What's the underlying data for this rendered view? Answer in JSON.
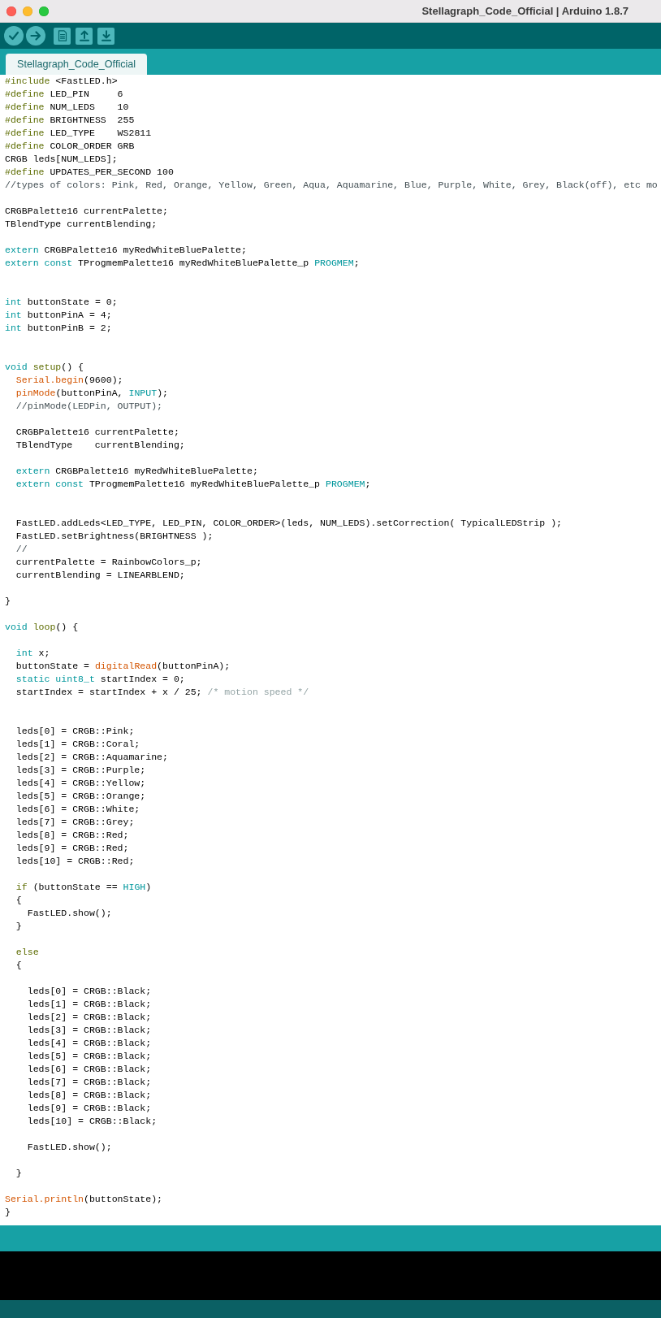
{
  "window": {
    "title": "Stellagraph_Code_Official | Arduino 1.8.7"
  },
  "toolbar": {
    "buttons": [
      {
        "kind": "verify"
      },
      {
        "kind": "upload"
      },
      {
        "kind": "new"
      },
      {
        "kind": "open"
      },
      {
        "kind": "save"
      }
    ]
  },
  "tabs": [
    {
      "label": "Stellagraph_Code_Official",
      "selected": true
    }
  ],
  "editor": {
    "lines": [
      {
        "kind": "code",
        "segments": [
          {
            "kind": "preprocessor",
            "text": "#include"
          },
          {
            "kind": "plain",
            "text": " <FastLED.h>"
          }
        ]
      },
      {
        "kind": "code",
        "segments": [
          {
            "kind": "preprocessor",
            "text": "#define"
          },
          {
            "kind": "plain",
            "text": " LED_PIN     6"
          }
        ]
      },
      {
        "kind": "code",
        "segments": [
          {
            "kind": "preprocessor",
            "text": "#define"
          },
          {
            "kind": "plain",
            "text": " NUM_LEDS    10"
          }
        ]
      },
      {
        "kind": "code",
        "segments": [
          {
            "kind": "preprocessor",
            "text": "#define"
          },
          {
            "kind": "plain",
            "text": " BRIGHTNESS  255"
          }
        ]
      },
      {
        "kind": "code",
        "segments": [
          {
            "kind": "preprocessor",
            "text": "#define"
          },
          {
            "kind": "plain",
            "text": " LED_TYPE    WS2811"
          }
        ]
      },
      {
        "kind": "code",
        "segments": [
          {
            "kind": "preprocessor",
            "text": "#define"
          },
          {
            "kind": "plain",
            "text": " COLOR_ORDER GRB"
          }
        ]
      },
      {
        "kind": "code",
        "segments": [
          {
            "kind": "plain",
            "text": "CRGB leds[NUM_LEDS];"
          }
        ]
      },
      {
        "kind": "code",
        "segments": [
          {
            "kind": "preprocessor",
            "text": "#define"
          },
          {
            "kind": "plain",
            "text": " UPDATES_PER_SECOND 100"
          }
        ]
      },
      {
        "kind": "code",
        "segments": [
          {
            "kind": "comment",
            "text": "//types of colors: Pink, Red, Orange, Yellow, Green, Aqua, Aquamarine, Blue, Purple, White, Grey, Black(off), etc mo"
          }
        ]
      },
      {
        "kind": "blank"
      },
      {
        "kind": "code",
        "segments": [
          {
            "kind": "plain",
            "text": "CRGBPalette16 currentPalette;"
          }
        ]
      },
      {
        "kind": "code",
        "segments": [
          {
            "kind": "plain",
            "text": "TBlendType currentBlending;"
          }
        ]
      },
      {
        "kind": "blank"
      },
      {
        "kind": "code",
        "segments": [
          {
            "kind": "keyword",
            "text": "extern"
          },
          {
            "kind": "plain",
            "text": " CRGBPalette16 myRedWhiteBluePalette;"
          }
        ]
      },
      {
        "kind": "code",
        "segments": [
          {
            "kind": "keyword",
            "text": "extern const"
          },
          {
            "kind": "plain",
            "text": " TProgmemPalette16 myRedWhiteBluePalette_p "
          },
          {
            "kind": "keyword",
            "text": "PROGMEM"
          },
          {
            "kind": "plain",
            "text": ";"
          }
        ]
      },
      {
        "kind": "blank"
      },
      {
        "kind": "blank"
      },
      {
        "kind": "code",
        "segments": [
          {
            "kind": "keyword",
            "text": "int"
          },
          {
            "kind": "plain",
            "text": " buttonState = 0;"
          }
        ]
      },
      {
        "kind": "code",
        "segments": [
          {
            "kind": "keyword",
            "text": "int"
          },
          {
            "kind": "plain",
            "text": " buttonPinA = 4;"
          }
        ]
      },
      {
        "kind": "code",
        "segments": [
          {
            "kind": "keyword",
            "text": "int"
          },
          {
            "kind": "plain",
            "text": " buttonPinB = 2;"
          }
        ]
      },
      {
        "kind": "blank"
      },
      {
        "kind": "blank"
      },
      {
        "kind": "code",
        "segments": [
          {
            "kind": "keyword",
            "text": "void"
          },
          {
            "kind": "control",
            "text": " setup"
          },
          {
            "kind": "plain",
            "text": "() {"
          }
        ]
      },
      {
        "kind": "code",
        "segments": [
          {
            "kind": "function",
            "text": "  Serial.begin"
          },
          {
            "kind": "plain",
            "text": "(9600);"
          }
        ]
      },
      {
        "kind": "code",
        "segments": [
          {
            "kind": "function",
            "text": "  pinMode"
          },
          {
            "kind": "plain",
            "text": "(buttonPinA, "
          },
          {
            "kind": "keyword",
            "text": "INPUT"
          },
          {
            "kind": "plain",
            "text": ");"
          }
        ]
      },
      {
        "kind": "code",
        "segments": [
          {
            "kind": "comment",
            "text": "  //pinMode(LEDPin, OUTPUT);"
          }
        ]
      },
      {
        "kind": "blank"
      },
      {
        "kind": "code",
        "segments": [
          {
            "kind": "plain",
            "text": "  CRGBPalette16 currentPalette;"
          }
        ]
      },
      {
        "kind": "code",
        "segments": [
          {
            "kind": "plain",
            "text": "  TBlendType    currentBlending;"
          }
        ]
      },
      {
        "kind": "blank"
      },
      {
        "kind": "code",
        "segments": [
          {
            "kind": "keyword",
            "text": "  extern"
          },
          {
            "kind": "plain",
            "text": " CRGBPalette16 myRedWhiteBluePalette;"
          }
        ]
      },
      {
        "kind": "code",
        "segments": [
          {
            "kind": "keyword",
            "text": "  extern const"
          },
          {
            "kind": "plain",
            "text": " TProgmemPalette16 myRedWhiteBluePalette_p "
          },
          {
            "kind": "keyword",
            "text": "PROGMEM"
          },
          {
            "kind": "plain",
            "text": ";"
          }
        ]
      },
      {
        "kind": "blank"
      },
      {
        "kind": "blank"
      },
      {
        "kind": "code",
        "segments": [
          {
            "kind": "plain",
            "text": "  FastLED.addLeds<LED_TYPE, LED_PIN, COLOR_ORDER>(leds, NUM_LEDS).setCorrection( TypicalLEDStrip );"
          }
        ]
      },
      {
        "kind": "code",
        "segments": [
          {
            "kind": "plain",
            "text": "  FastLED.setBrightness(BRIGHTNESS );"
          }
        ]
      },
      {
        "kind": "code",
        "segments": [
          {
            "kind": "comment",
            "text": "  //"
          }
        ]
      },
      {
        "kind": "code",
        "segments": [
          {
            "kind": "plain",
            "text": "  currentPalette = RainbowColors_p;"
          }
        ]
      },
      {
        "kind": "code",
        "segments": [
          {
            "kind": "plain",
            "text": "  currentBlending = LINEARBLEND;"
          }
        ]
      },
      {
        "kind": "blank"
      },
      {
        "kind": "code",
        "segments": [
          {
            "kind": "plain",
            "text": "}"
          }
        ]
      },
      {
        "kind": "blank"
      },
      {
        "kind": "code",
        "segments": [
          {
            "kind": "keyword",
            "text": "void"
          },
          {
            "kind": "control",
            "text": " loop"
          },
          {
            "kind": "plain",
            "text": "() {"
          }
        ]
      },
      {
        "kind": "blank"
      },
      {
        "kind": "code",
        "segments": [
          {
            "kind": "keyword",
            "text": "  int"
          },
          {
            "kind": "plain",
            "text": " x;"
          }
        ]
      },
      {
        "kind": "code",
        "segments": [
          {
            "kind": "plain",
            "text": "  buttonState = "
          },
          {
            "kind": "function",
            "text": "digitalRead"
          },
          {
            "kind": "plain",
            "text": "(buttonPinA);"
          }
        ]
      },
      {
        "kind": "code",
        "segments": [
          {
            "kind": "keyword",
            "text": "  static uint8_t"
          },
          {
            "kind": "plain",
            "text": " startIndex = 0;"
          }
        ]
      },
      {
        "kind": "code",
        "segments": [
          {
            "kind": "plain",
            "text": "  startIndex = startIndex + x / 25; "
          },
          {
            "kind": "block_comment",
            "text": "/* motion speed */"
          }
        ]
      },
      {
        "kind": "blank"
      },
      {
        "kind": "blank"
      },
      {
        "kind": "code",
        "segments": [
          {
            "kind": "plain",
            "text": "  leds[0] = CRGB::Pink;"
          }
        ]
      },
      {
        "kind": "code",
        "segments": [
          {
            "kind": "plain",
            "text": "  leds[1] = CRGB::Coral;"
          }
        ]
      },
      {
        "kind": "code",
        "segments": [
          {
            "kind": "plain",
            "text": "  leds[2] = CRGB::Aquamarine;"
          }
        ]
      },
      {
        "kind": "code",
        "segments": [
          {
            "kind": "plain",
            "text": "  leds[3] = CRGB::Purple;"
          }
        ]
      },
      {
        "kind": "code",
        "segments": [
          {
            "kind": "plain",
            "text": "  leds[4] = CRGB::Yellow;"
          }
        ]
      },
      {
        "kind": "code",
        "segments": [
          {
            "kind": "plain",
            "text": "  leds[5] = CRGB::Orange;"
          }
        ]
      },
      {
        "kind": "code",
        "segments": [
          {
            "kind": "plain",
            "text": "  leds[6] = CRGB::White;"
          }
        ]
      },
      {
        "kind": "code",
        "segments": [
          {
            "kind": "plain",
            "text": "  leds[7] = CRGB::Grey;"
          }
        ]
      },
      {
        "kind": "code",
        "segments": [
          {
            "kind": "plain",
            "text": "  leds[8] = CRGB::Red;"
          }
        ]
      },
      {
        "kind": "code",
        "segments": [
          {
            "kind": "plain",
            "text": "  leds[9] = CRGB::Red;"
          }
        ]
      },
      {
        "kind": "code",
        "segments": [
          {
            "kind": "plain",
            "text": "  leds[10] = CRGB::Red;"
          }
        ]
      },
      {
        "kind": "blank"
      },
      {
        "kind": "code",
        "segments": [
          {
            "kind": "control",
            "text": "  if"
          },
          {
            "kind": "plain",
            "text": " (buttonState == "
          },
          {
            "kind": "keyword",
            "text": "HIGH"
          },
          {
            "kind": "plain",
            "text": ")"
          }
        ]
      },
      {
        "kind": "code",
        "segments": [
          {
            "kind": "plain",
            "text": "  {"
          }
        ]
      },
      {
        "kind": "code",
        "segments": [
          {
            "kind": "plain",
            "text": "    FastLED.show();"
          }
        ]
      },
      {
        "kind": "code",
        "segments": [
          {
            "kind": "plain",
            "text": "  }"
          }
        ]
      },
      {
        "kind": "blank"
      },
      {
        "kind": "code",
        "segments": [
          {
            "kind": "control",
            "text": "  else"
          }
        ]
      },
      {
        "kind": "code",
        "segments": [
          {
            "kind": "plain",
            "text": "  {"
          }
        ]
      },
      {
        "kind": "blank"
      },
      {
        "kind": "code",
        "segments": [
          {
            "kind": "plain",
            "text": "    leds[0] = CRGB::Black;"
          }
        ]
      },
      {
        "kind": "code",
        "segments": [
          {
            "kind": "plain",
            "text": "    leds[1] = CRGB::Black;"
          }
        ]
      },
      {
        "kind": "code",
        "segments": [
          {
            "kind": "plain",
            "text": "    leds[2] = CRGB::Black;"
          }
        ]
      },
      {
        "kind": "code",
        "segments": [
          {
            "kind": "plain",
            "text": "    leds[3] = CRGB::Black;"
          }
        ]
      },
      {
        "kind": "code",
        "segments": [
          {
            "kind": "plain",
            "text": "    leds[4] = CRGB::Black;"
          }
        ]
      },
      {
        "kind": "code",
        "segments": [
          {
            "kind": "plain",
            "text": "    leds[5] = CRGB::Black;"
          }
        ]
      },
      {
        "kind": "code",
        "segments": [
          {
            "kind": "plain",
            "text": "    leds[6] = CRGB::Black;"
          }
        ]
      },
      {
        "kind": "code",
        "segments": [
          {
            "kind": "plain",
            "text": "    leds[7] = CRGB::Black;"
          }
        ]
      },
      {
        "kind": "code",
        "segments": [
          {
            "kind": "plain",
            "text": "    leds[8] = CRGB::Black;"
          }
        ]
      },
      {
        "kind": "code",
        "segments": [
          {
            "kind": "plain",
            "text": "    leds[9] = CRGB::Black;"
          }
        ]
      },
      {
        "kind": "code",
        "segments": [
          {
            "kind": "plain",
            "text": "    leds[10] = CRGB::Black;"
          }
        ]
      },
      {
        "kind": "blank"
      },
      {
        "kind": "code",
        "segments": [
          {
            "kind": "plain",
            "text": "    FastLED.show();"
          }
        ]
      },
      {
        "kind": "blank"
      },
      {
        "kind": "code",
        "segments": [
          {
            "kind": "plain",
            "text": "  }"
          }
        ]
      },
      {
        "kind": "blank"
      },
      {
        "kind": "code",
        "segments": [
          {
            "kind": "function",
            "text": "Serial.println"
          },
          {
            "kind": "plain",
            "text": "(buttonState);"
          }
        ]
      },
      {
        "kind": "code",
        "segments": [
          {
            "kind": "plain",
            "text": "}"
          }
        ]
      }
    ]
  }
}
